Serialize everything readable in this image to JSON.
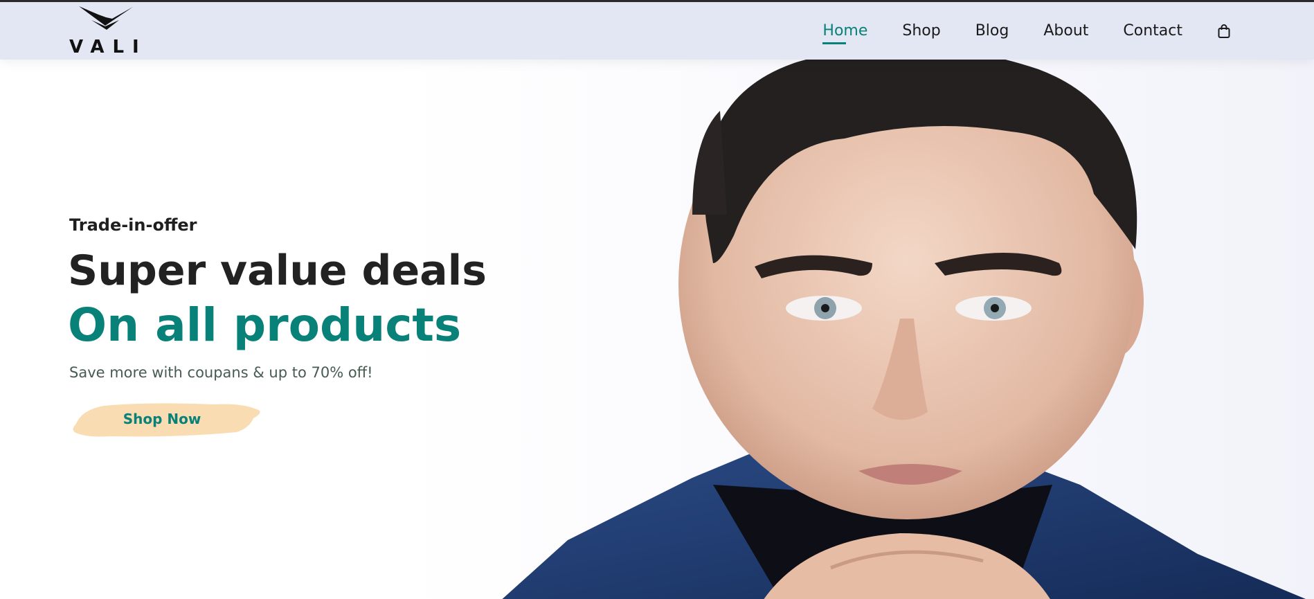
{
  "brand": {
    "name": "VALI"
  },
  "nav": {
    "items": [
      {
        "label": "Home",
        "active": true
      },
      {
        "label": "Shop"
      },
      {
        "label": "Blog"
      },
      {
        "label": "About"
      },
      {
        "label": "Contact"
      }
    ],
    "cart_icon": "shopping-bag-icon"
  },
  "hero": {
    "eyebrow": "Trade-in-offer",
    "title_line1": "Super value deals",
    "title_line2": "On all products",
    "subtitle": "Save more with coupans & up to 70% off!",
    "cta_label": "Shop Now"
  },
  "colors": {
    "accent": "#088178",
    "header_bg": "#e3e6f3",
    "cta_brush": "#f9dcb2",
    "jacket": "#1f3a6e"
  }
}
